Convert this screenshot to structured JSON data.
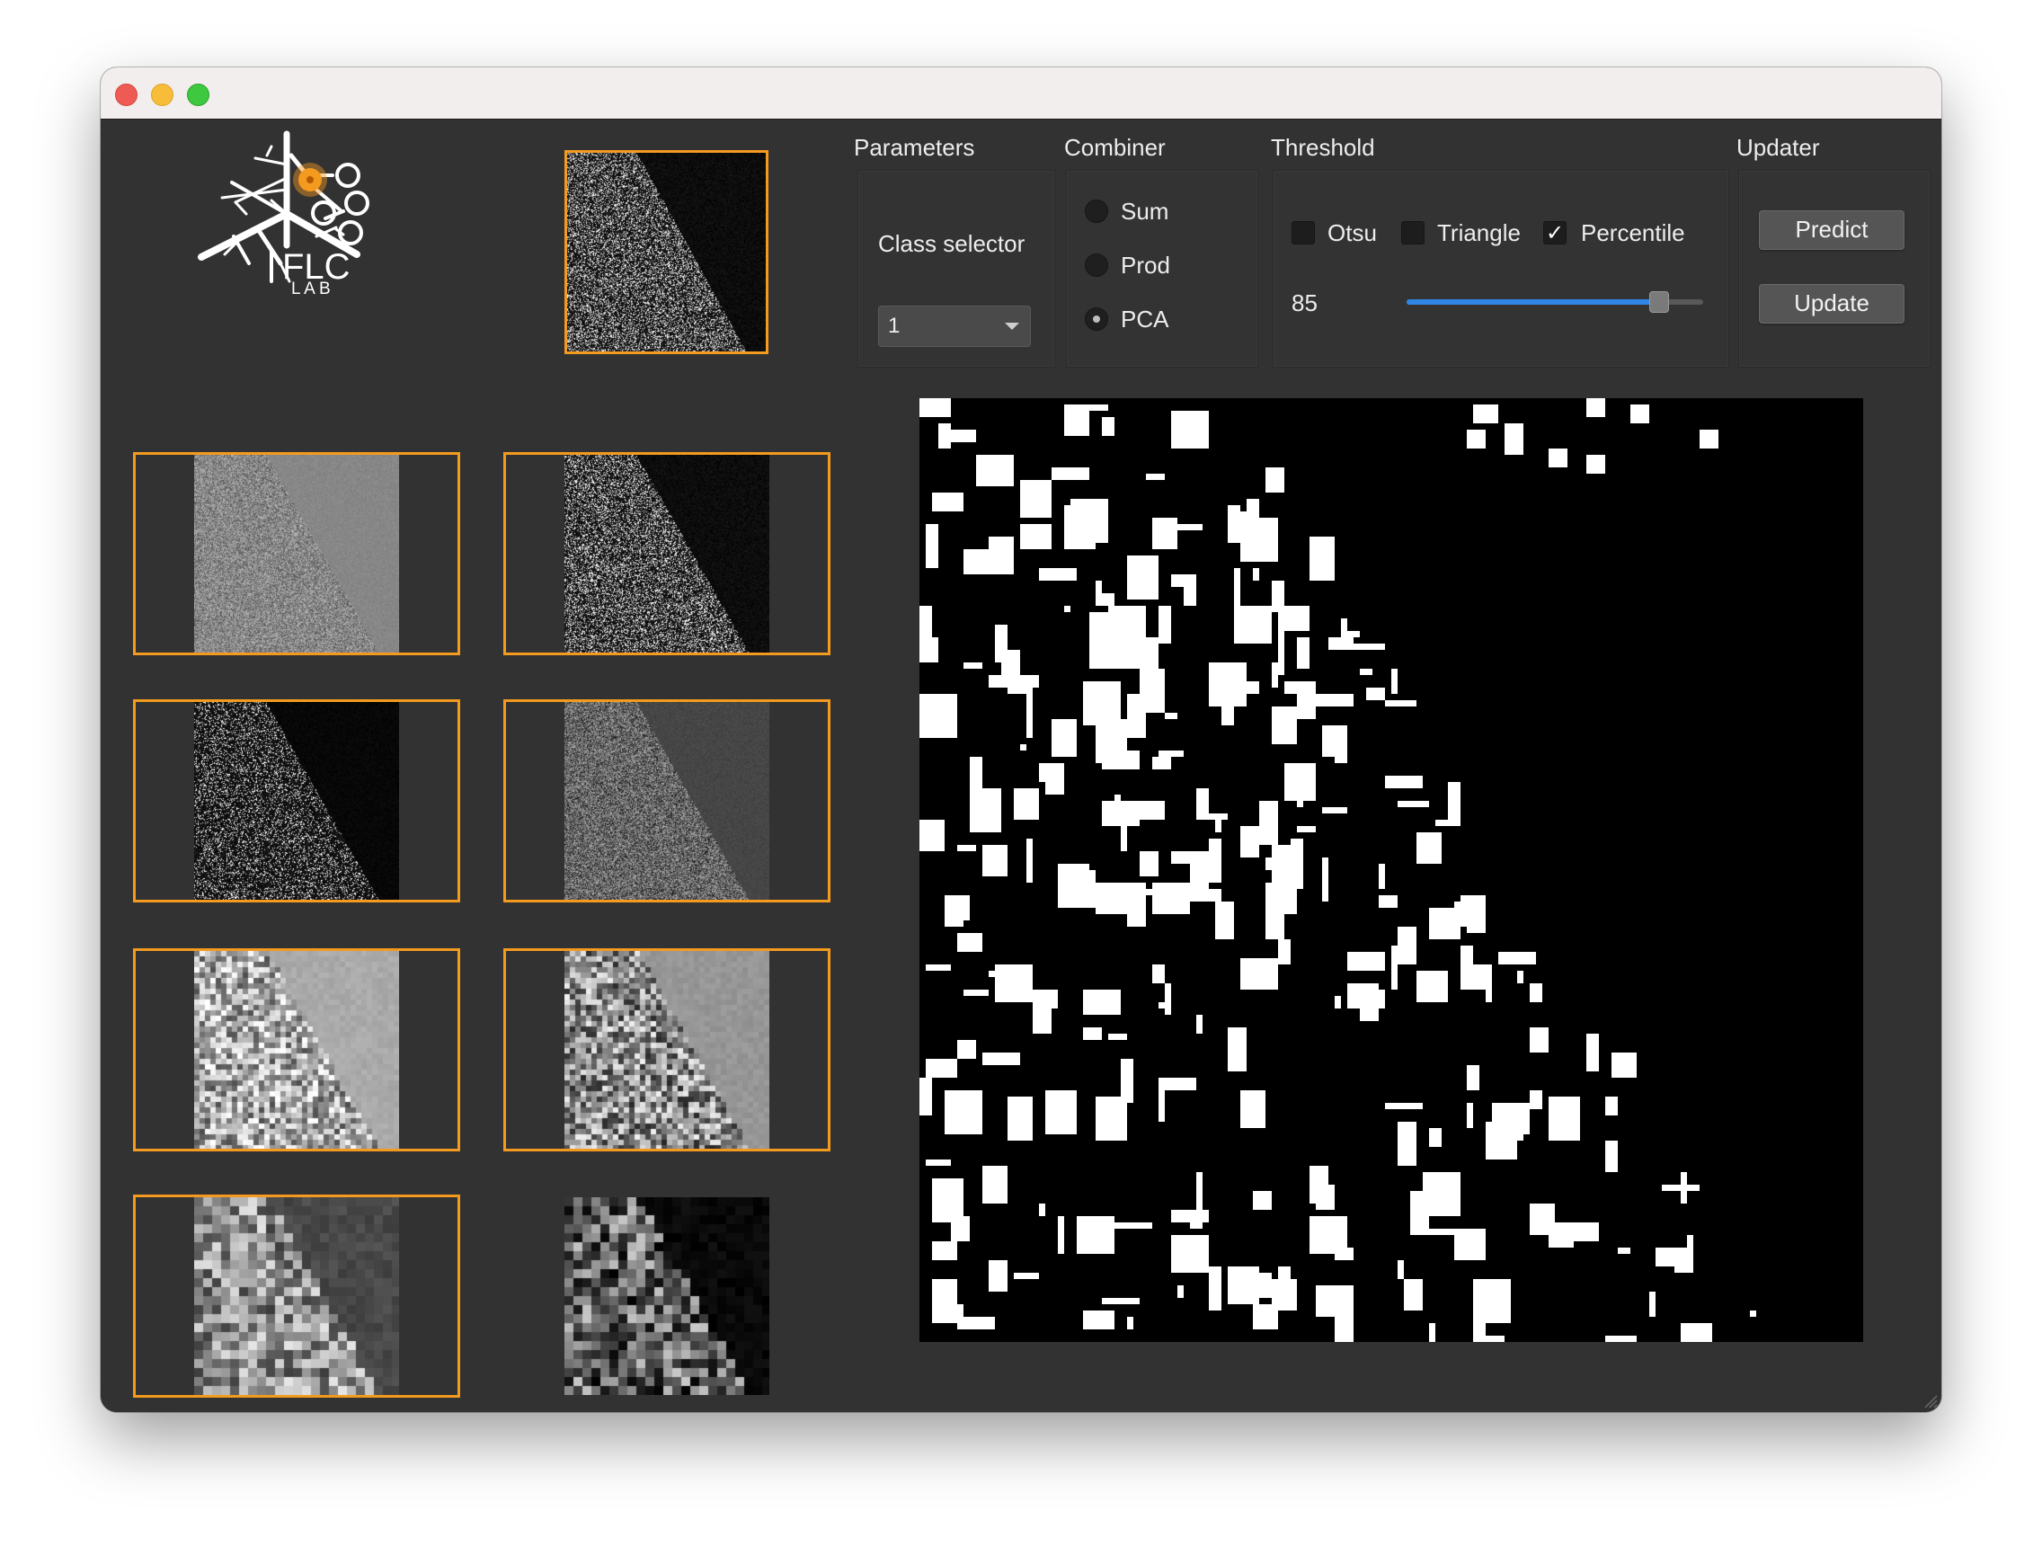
{
  "window": {
    "title": ""
  },
  "logo": {
    "letters_top": "FLC",
    "letters_bottom": "L A B"
  },
  "groups": {
    "parameters": {
      "title": "Parameters",
      "class_selector_label": "Class selector",
      "class_selector_value": "1"
    },
    "combiner": {
      "title": "Combiner",
      "options": [
        "Sum",
        "Prod",
        "PCA"
      ],
      "selected": "PCA"
    },
    "threshold": {
      "title": "Threshold",
      "otsu_label": "Otsu",
      "triangle_label": "Triangle",
      "percentile_label": "Percentile",
      "otsu_checked": false,
      "triangle_checked": false,
      "percentile_checked": true,
      "check_mark": "✓",
      "value": "85",
      "slider_fraction": 0.85
    },
    "updater": {
      "title": "Updater",
      "predict_label": "Predict",
      "update_label": "Update"
    }
  },
  "colors": {
    "accent_orange": "#f39a1f",
    "slider_blue": "#2f86e6",
    "background": "#323232"
  },
  "icons": [
    "close-icon",
    "minimize-icon",
    "zoom-icon",
    "flc-lab-logo",
    "chevron-down-icon",
    "resize-grip-icon"
  ]
}
